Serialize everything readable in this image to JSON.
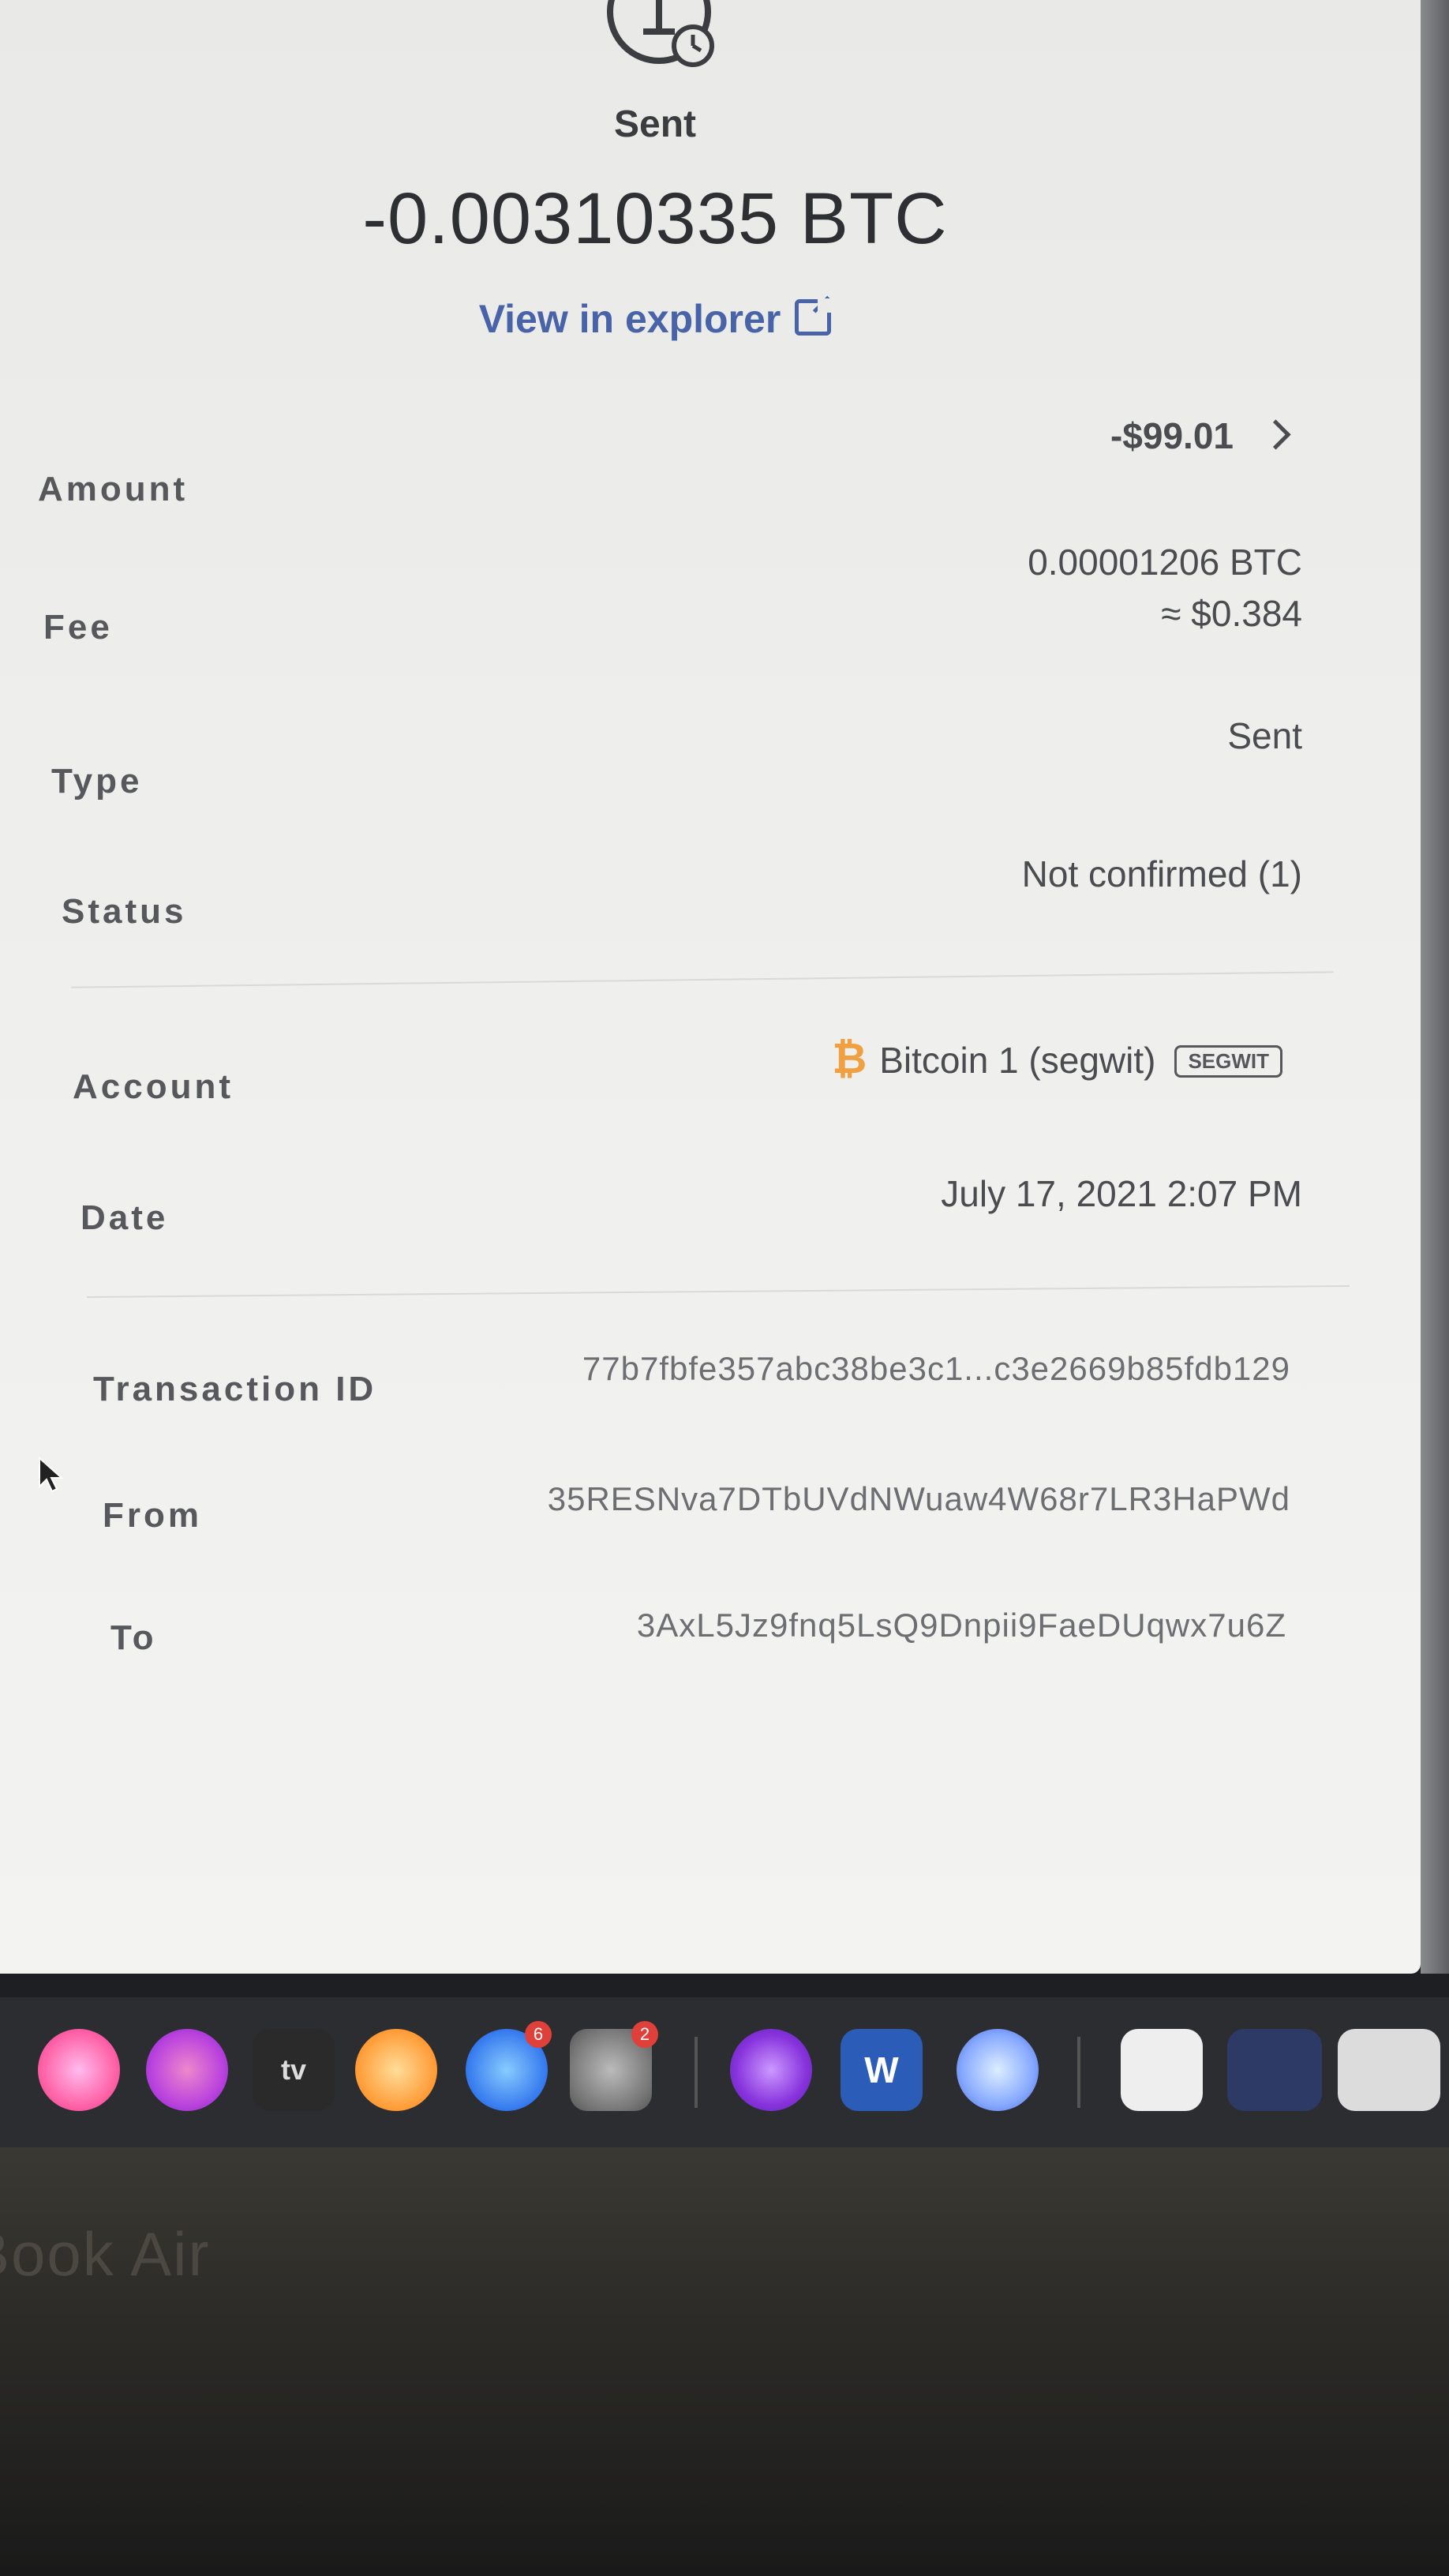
{
  "header": {
    "status_title": "Sent",
    "amount": "-0.00310335 BTC",
    "explorer_link": "View in explorer"
  },
  "details": {
    "amount": {
      "label": "Amount",
      "value": "-$99.01"
    },
    "fee": {
      "label": "Fee",
      "value_btc": "0.00001206 BTC",
      "value_fiat": "≈ $0.384"
    },
    "type": {
      "label": "Type",
      "value": "Sent"
    },
    "status": {
      "label": "Status",
      "value": "Not confirmed (1)"
    },
    "account": {
      "label": "Account",
      "value": "Bitcoin 1 (segwit)",
      "badge": "SEGWIT",
      "coin_symbol": "₿"
    },
    "date": {
      "label": "Date",
      "value": "July 17, 2021 2:07 PM"
    },
    "transaction_id": {
      "label": "Transaction ID",
      "value": "77b7fbfe357abc38be3c1...c3e2669b85fdb129"
    },
    "from": {
      "label": "From",
      "value": "35RESNva7DTbUVdNWuaw4W68r7LR3HaPWd"
    },
    "to": {
      "label": "To",
      "value": "3AxL5Jz9fnq5LsQ9Dnpii9FaeDUqwx7u6Z"
    }
  },
  "dock": {
    "apps": [
      "music-icon",
      "podcasts-icon",
      "appletv-icon",
      "books-icon",
      "appstore-icon",
      "system-preferences-icon",
      "tor-browser-icon",
      "word-icon",
      "sync-icon",
      "keychain-icon",
      "window-icon",
      "finder-window-icon"
    ],
    "appletv_label": "tv",
    "appstore_badge": "6",
    "sysprefs_badge": "2"
  },
  "bezel": {
    "brand": "Book Air"
  },
  "colors": {
    "link": "#4863a8",
    "coin": "#f0a040",
    "badge_red": "#e0403a"
  }
}
